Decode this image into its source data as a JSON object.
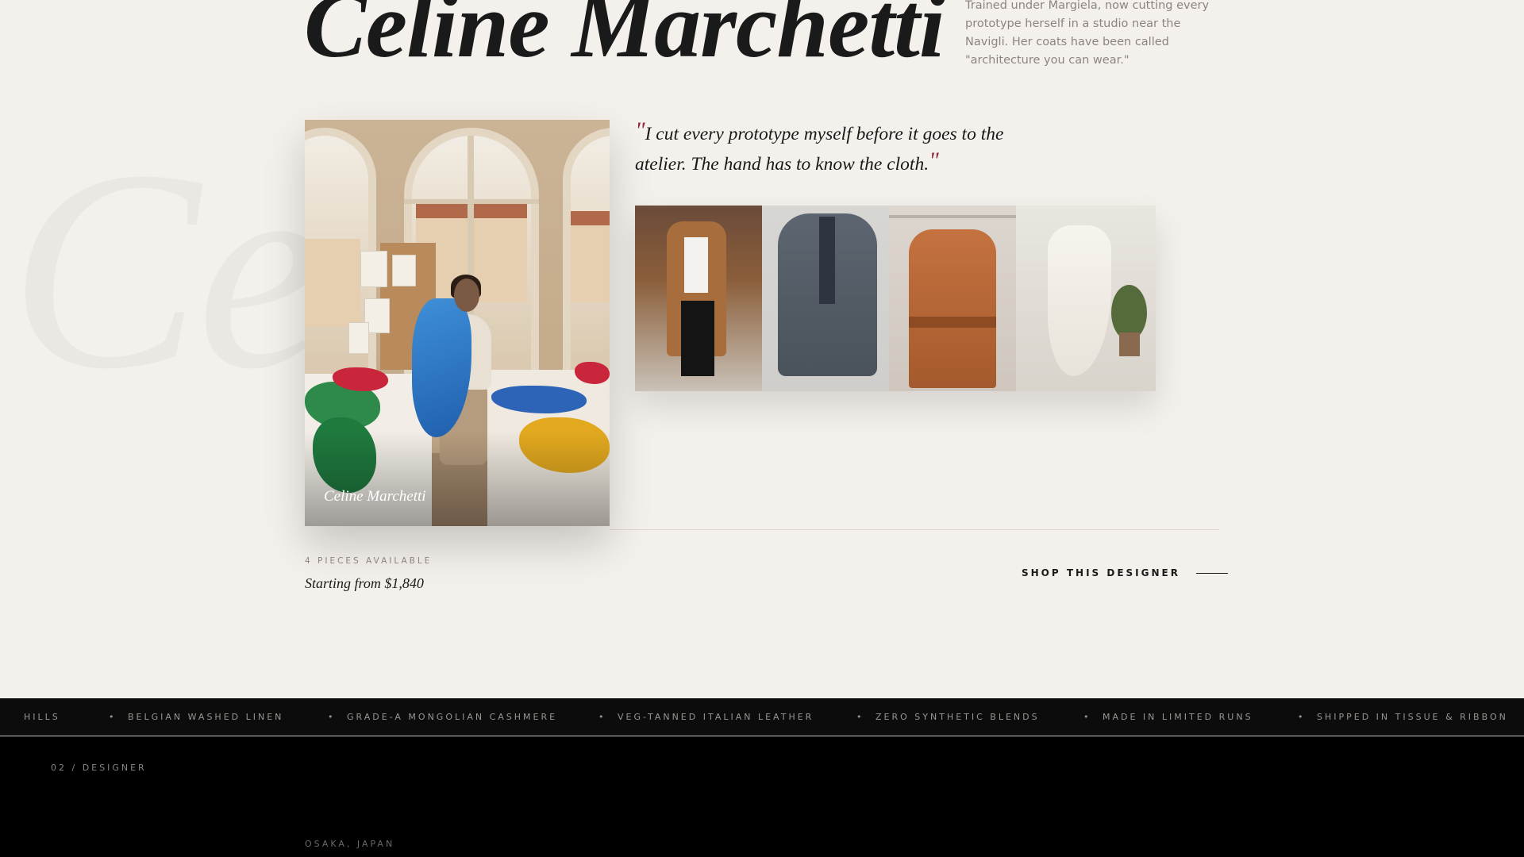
{
  "designer": {
    "ghost_text": "Cel",
    "name": "Celine Marchetti",
    "bio": "Trained under Margiela, now cutting every prototype herself in a studio near the Navigli. Her coats have been called \"architecture you can wear.\"",
    "portrait_caption": "Celine Marchetti",
    "quote": "I cut every prototype myself before it goes to the atelier. The hand has to know the cloth.",
    "quote_open": "\"",
    "quote_close": "\"",
    "pieces_available": "4 PIECES AVAILABLE",
    "starting_price": "Starting from $1,840",
    "shop_label": "SHOP THIS DESIGNER"
  },
  "gallery": [
    {
      "name": "camel-coat-look"
    },
    {
      "name": "grey-blazer"
    },
    {
      "name": "tan-trench-coat"
    },
    {
      "name": "ivory-slip-dress"
    }
  ],
  "marquee": {
    "items": [
      "HILLS",
      "BELGIAN WASHED LINEN",
      "GRADE-A MONGOLIAN CASHMERE",
      "VEG-TANNED ITALIAN LEATHER",
      "ZERO SYNTHETIC BLENDS",
      "MADE IN LIMITED RUNS",
      "SHIPPED IN TISSUE & RIBBON"
    ],
    "separator": "•"
  },
  "next_section": {
    "label": "02 / DESIGNER",
    "location": "OSAKA, JAPAN"
  },
  "colors": {
    "background": "#f4f0ec",
    "accent_quote": "#8c2b3a",
    "dark_band": "#0c0c0c"
  }
}
